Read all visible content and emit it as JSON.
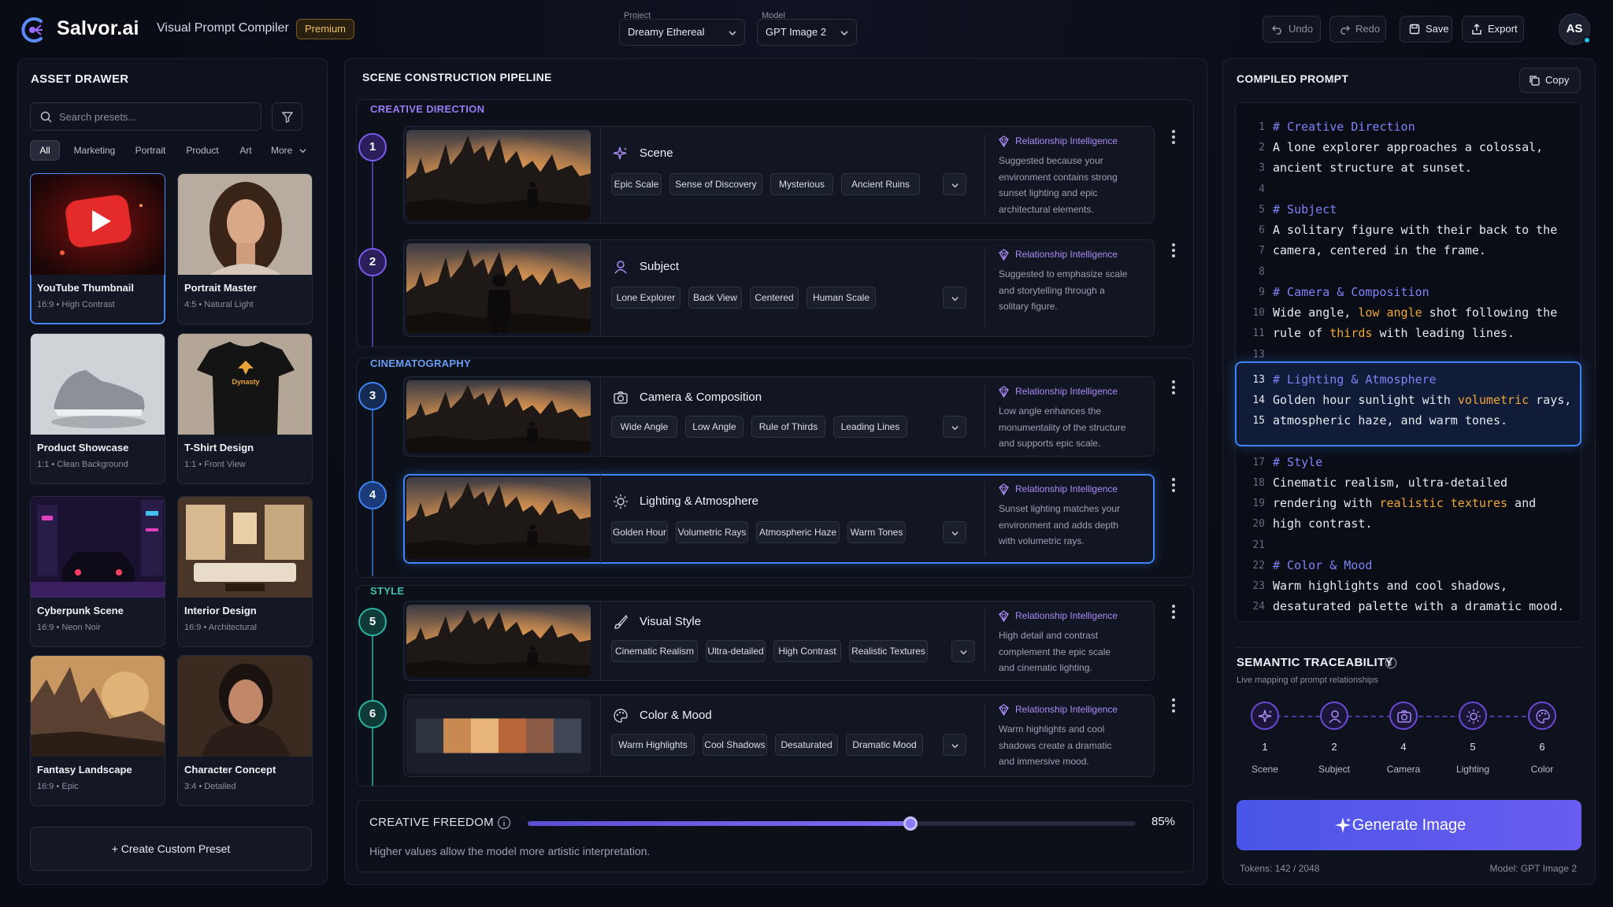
{
  "brand": {
    "name": "Salvor.ai",
    "subtitle": "Visual Prompt Compiler",
    "badge": "Premium"
  },
  "header": {
    "project_label": "Project",
    "project_value": "Dreamy Ethereal",
    "model_label": "Model",
    "model_value": "GPT Image 2",
    "undo": "Undo",
    "redo": "Redo",
    "save": "Save",
    "export": "Export",
    "avatar": "AS"
  },
  "drawer": {
    "title": "ASSET DRAWER",
    "search_placeholder": "Search presets...",
    "categories": [
      "All",
      "Marketing",
      "Portrait",
      "Product",
      "Art",
      "More"
    ],
    "cards": [
      {
        "name": "YouTube Thumbnail",
        "meta": "16:9  •  High Contrast"
      },
      {
        "name": "Portrait Master",
        "meta": "4:5  •  Natural Light"
      },
      {
        "name": "Product Showcase",
        "meta": "1:1  •  Clean Background"
      },
      {
        "name": "T-Shirt Design",
        "meta": "1:1  •  Front View"
      },
      {
        "name": "Cyberpunk Scene",
        "meta": "16:9  •  Neon Noir"
      },
      {
        "name": "Interior Design",
        "meta": "16:9  •  Architectural"
      },
      {
        "name": "Fantasy Landscape",
        "meta": "16:9  •  Epic"
      },
      {
        "name": "Character Concept",
        "meta": "3:4  •  Detailed"
      }
    ],
    "tshirt_text": "Dynasty",
    "create_label": "+ Create Custom Preset"
  },
  "pipeline": {
    "title": "SCENE CONSTRUCTION PIPELINE",
    "sections": [
      "CREATIVE DIRECTION",
      "CINEMATOGRAPHY",
      "STYLE"
    ],
    "ri_label": "Relationship Intelligence",
    "rows": [
      {
        "num": "1",
        "title": "Scene",
        "chips": [
          "Epic Scale",
          "Sense of Discovery",
          "Mysterious",
          "Ancient Ruins"
        ],
        "ri_lines": [
          "Suggested because your",
          "environment contains strong",
          "sunset lighting and epic",
          "architectural elements."
        ]
      },
      {
        "num": "2",
        "title": "Subject",
        "chips": [
          "Lone Explorer",
          "Back View",
          "Centered",
          "Human Scale"
        ],
        "ri_lines": [
          "Suggested to emphasize scale",
          "and storytelling through a",
          "solitary figure."
        ]
      },
      {
        "num": "3",
        "title": "Camera & Composition",
        "chips": [
          "Wide Angle",
          "Low Angle",
          "Rule of Thirds",
          "Leading Lines"
        ],
        "ri_lines": [
          "Low angle enhances the",
          "monumentality of the structure",
          "and supports epic scale."
        ]
      },
      {
        "num": "4",
        "title": "Lighting & Atmosphere",
        "chips": [
          "Golden Hour",
          "Volumetric Rays",
          "Atmospheric Haze",
          "Warm Tones"
        ],
        "ri_lines": [
          "Sunset lighting matches your",
          "environment and adds depth",
          "with volumetric rays."
        ]
      },
      {
        "num": "5",
        "title": "Visual Style",
        "chips": [
          "Cinematic Realism",
          "Ultra-detailed",
          "High Contrast",
          "Realistic Textures"
        ],
        "ri_lines": [
          "High detail and contrast",
          "complement the epic scale",
          "and cinematic lighting."
        ]
      },
      {
        "num": "6",
        "title": "Color & Mood",
        "chips": [
          "Warm Highlights",
          "Cool Shadows",
          "Desaturated",
          "Dramatic Mood"
        ],
        "ri_lines": [
          "Warm highlights and cool",
          "shadows create a dramatic",
          "and immersive mood."
        ]
      }
    ],
    "palette": [
      "#2e3340",
      "#c98a52",
      "#e7b57a",
      "#b8663a",
      "#8a5a44",
      "#3f4656"
    ],
    "freedom_label": "CREATIVE FREEDOM",
    "freedom_value": "85%",
    "freedom_level": 0.85,
    "freedom_help": "Higher values allow the model more artistic interpretation."
  },
  "compiled": {
    "title": "COMPILED PROMPT",
    "copy": "Copy",
    "lines": [
      {
        "n": "1",
        "t": "# Creative Direction"
      },
      {
        "n": "2",
        "t": "A lone explorer approaches a colossal,"
      },
      {
        "n": "3",
        "t": "ancient structure at sunset."
      },
      {
        "n": "4",
        "t": ""
      },
      {
        "n": "5",
        "t": "# Subject"
      },
      {
        "n": "6",
        "t": "A solitary figure with their back to the"
      },
      {
        "n": "7",
        "t": "camera, centered in the frame."
      },
      {
        "n": "8",
        "t": ""
      },
      {
        "n": "9",
        "t": "# Camera & Composition"
      },
      {
        "n": "10",
        "t": "Wide angle, low angle shot following the"
      },
      {
        "n": "11",
        "t": "rule of thirds with leading lines."
      },
      {
        "n": "13",
        "t": ""
      },
      {
        "n": "13",
        "t": "# Lighting & Atmosphere"
      },
      {
        "n": "14",
        "t": "Golden hour sunlight with volumetric rays,"
      },
      {
        "n": "15",
        "t": "atmospheric haze, and warm tones."
      },
      {
        "n": "17",
        "t": "# Style"
      },
      {
        "n": "18",
        "t": "Cinematic realism, ultra-detailed"
      },
      {
        "n": "19",
        "t": "rendering with realistic textures and"
      },
      {
        "n": "20",
        "t": "high contrast."
      },
      {
        "n": "21",
        "t": ""
      },
      {
        "n": "22",
        "t": "# Color & Mood"
      },
      {
        "n": "23",
        "t": "Warm highlights and cool shadows,"
      },
      {
        "n": "24",
        "t": "desaturated palette with a dramatic mood."
      }
    ],
    "highlights": [
      "low angle",
      "thirds",
      "volumetric",
      "realistic textures"
    ],
    "trace_title": "SEMANTIC TRACEABILITY",
    "trace_sub": "Live mapping of prompt relationships",
    "trace_nodes": [
      {
        "num": "1",
        "name": "Scene"
      },
      {
        "num": "2",
        "name": "Subject"
      },
      {
        "num": "4",
        "name": "Camera"
      },
      {
        "num": "5",
        "name": "Lighting"
      },
      {
        "num": "6",
        "name": "Color"
      }
    ],
    "generate": "Generate Image",
    "tokens": "Tokens: 142 / 2048",
    "model_footer": "Model: GPT Image 2"
  }
}
